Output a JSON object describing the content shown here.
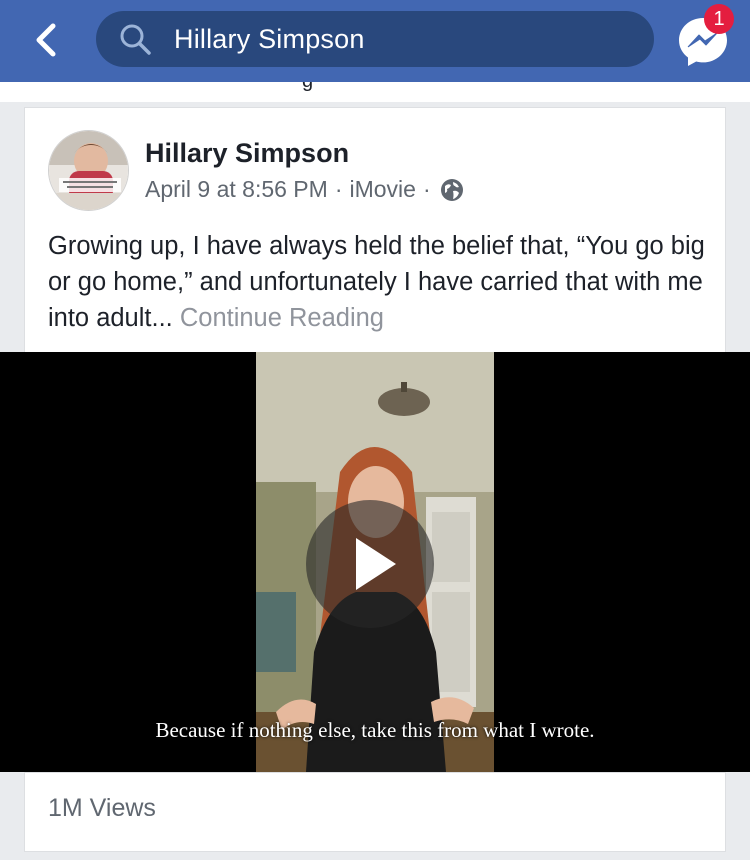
{
  "header": {
    "search_value": "Hillary Simpson",
    "messenger_badge": "1",
    "bar_color": "#4267b2"
  },
  "icons": {
    "back": "chevron-left-icon",
    "search": "search-icon",
    "messenger": "messenger-icon",
    "privacy": "globe-icon"
  },
  "post": {
    "author": "Hillary Simpson",
    "date": "April 9 at 8:56 PM",
    "app": "iMovie",
    "separator": "·",
    "text": "Growing up, I have always held the belief that, “You go big or go home,” and unfortunately I have carried that with me into adult...",
    "continue_label": "Continue Reading",
    "video_caption": "Because if nothing else, take this from what I wrote.",
    "views": "1M Views"
  }
}
